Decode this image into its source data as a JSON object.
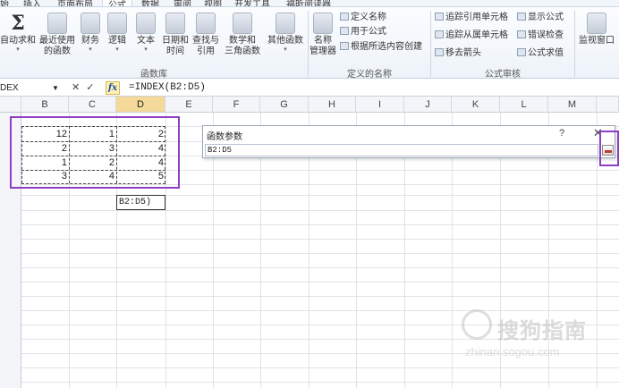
{
  "ribbon_tabs": [
    {
      "label": "始",
      "active": false
    },
    {
      "label": "插入",
      "active": false
    },
    {
      "label": "页面布局",
      "active": false
    },
    {
      "label": "公式",
      "active": true
    },
    {
      "label": "数据",
      "active": false
    },
    {
      "label": "审阅",
      "active": false
    },
    {
      "label": "视图",
      "active": false
    },
    {
      "label": "开发工具",
      "active": false
    },
    {
      "label": "福昕阅读器",
      "active": false
    }
  ],
  "function_library": {
    "group_label": "函数库",
    "buttons": [
      {
        "line1": "自动求和",
        "line2": "",
        "icon": "sigma-icon"
      },
      {
        "line1": "最近使用",
        "line2": "的函数",
        "icon": "book-icon"
      },
      {
        "line1": "财务",
        "line2": "",
        "icon": "book-icon"
      },
      {
        "line1": "逻辑",
        "line2": "",
        "icon": "question-book-icon"
      },
      {
        "line1": "文本",
        "line2": "",
        "icon": "text-book-icon"
      },
      {
        "line1": "日期和",
        "line2": "时间",
        "icon": "calendar-book-icon"
      },
      {
        "line1": "查找与",
        "line2": "引用",
        "icon": "search-book-icon"
      },
      {
        "line1": "数学和",
        "line2": "三角函数",
        "icon": "theta-book-icon"
      },
      {
        "line1": "其他函数",
        "line2": "",
        "icon": "more-book-icon"
      }
    ]
  },
  "defined_names": {
    "group_label": "定义的名称",
    "manager": {
      "line1": "名称",
      "line2": "管理器"
    },
    "items": [
      "定义名称",
      "用于公式",
      "根据所选内容创建"
    ]
  },
  "formula_auditing": {
    "group_label": "公式审核",
    "items": [
      "追踪引用单元格",
      "显示公式",
      "追踪从属单元格",
      "错误检查",
      "移去箭头",
      "公式求值"
    ],
    "watch_window": "监视窗口"
  },
  "formula_bar": {
    "name_box": "DEX",
    "cancel": "✕",
    "enter": "✓",
    "fx": "fx",
    "formula": "=INDEX(B2:D5)"
  },
  "columns": [
    "B",
    "C",
    "D",
    "E",
    "F",
    "G",
    "H",
    "I",
    "J",
    "K",
    "L",
    "M"
  ],
  "selected_column": "D",
  "cells": [
    {
      "row": 0,
      "B": "12",
      "C": "1",
      "D": "2"
    },
    {
      "row": 1,
      "B": "2",
      "C": "3",
      "D": "4"
    },
    {
      "row": 2,
      "B": "1",
      "C": "2",
      "D": "4"
    },
    {
      "row": 3,
      "B": "3",
      "C": "4",
      "D": "5"
    }
  ],
  "edit_cell_text": "B2:D5)",
  "dialog": {
    "title": "函数参数",
    "help": "?",
    "close": "✕",
    "range_value": "B2:D5"
  },
  "watermark": {
    "main": "搜狗指南",
    "url": "zhinan.sogou.com"
  },
  "colors": {
    "highlight_outline": "#8e3fc4",
    "selected_column_header": "#f5d99a"
  }
}
